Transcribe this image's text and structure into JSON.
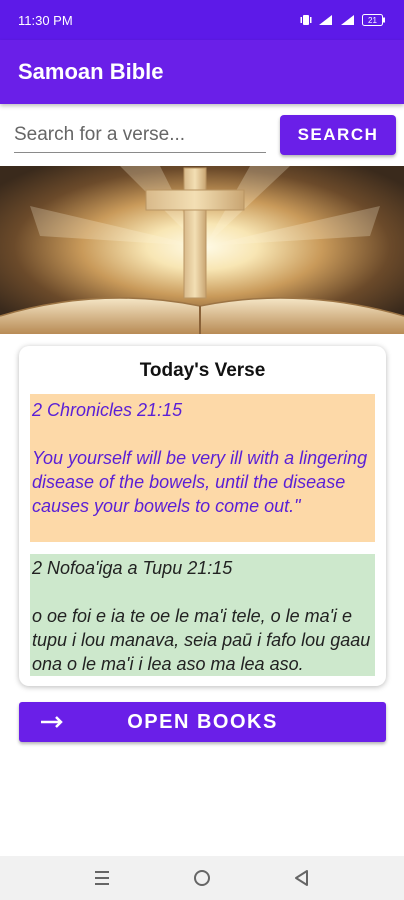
{
  "status_bar": {
    "time": "11:30 PM",
    "battery": "21"
  },
  "app_bar": {
    "title": "Samoan Bible"
  },
  "search": {
    "placeholder": "Search for a verse...",
    "value": "",
    "button_label": "SEARCH"
  },
  "verse_card": {
    "title": "Today's Verse",
    "english": {
      "reference": "2 Chronicles 21:15",
      "text": "You yourself will be very ill with a lingering disease of the bowels, until the disease causes your bowels to come out.\""
    },
    "samoan": {
      "reference": "2 Nofoa'iga a Tupu 21:15",
      "text": "o oe foi e ia te oe le ma'i tele, o le ma'i e tupu i lou manava, seia paū i fafo lou gaau ona o le ma'i i lea aso ma lea aso."
    }
  },
  "open_books": {
    "label": "OPEN BOOKS"
  },
  "colors": {
    "primary": "#6a1fe8",
    "status_bar": "#5d1ae8",
    "english_bg": "#fdd9a8",
    "english_text": "#5a1fd6",
    "samoan_bg": "#cde8cc"
  },
  "icons": {
    "hero": "cross-and-open-bible-image",
    "open_books": "right-arrow-icon",
    "nav": [
      "recents-icon",
      "home-icon",
      "back-icon"
    ]
  }
}
